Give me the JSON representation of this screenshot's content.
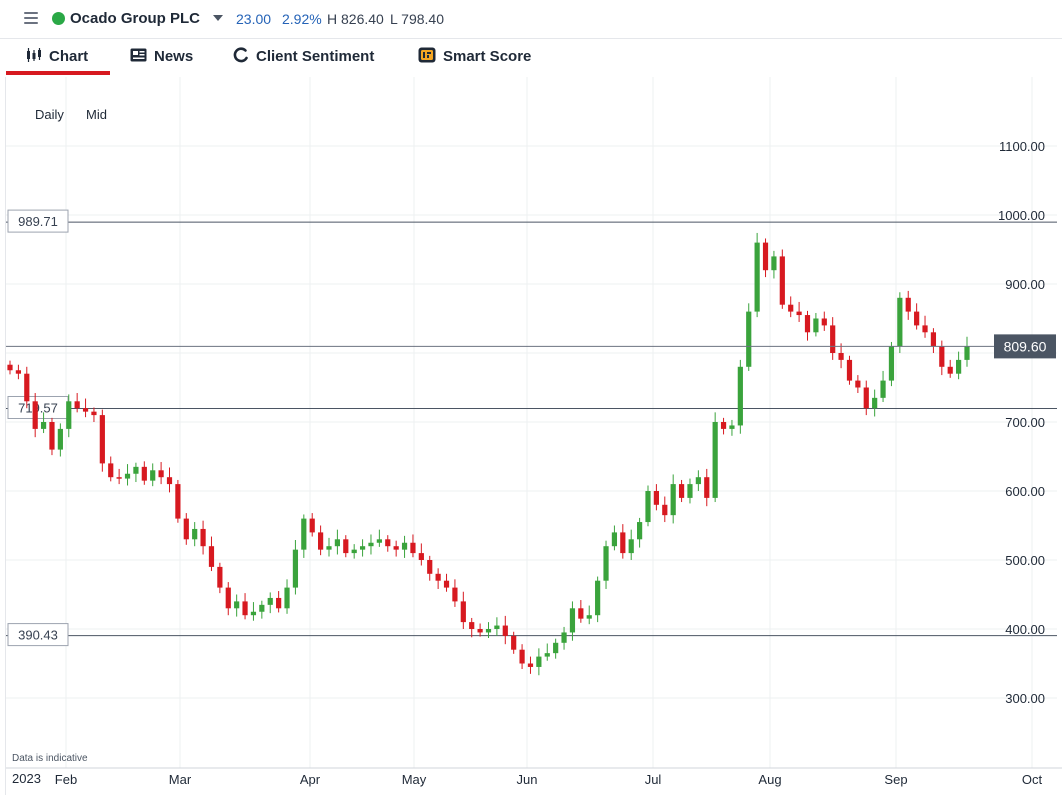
{
  "header": {
    "menu_icon": "hamburger-menu-icon",
    "status_color": "#2aa846",
    "instrument": "Ocado Group PLC",
    "change": "23.00",
    "change_pct": "2.92%",
    "high": "H 826.40",
    "low": "L 798.40"
  },
  "tabs": [
    {
      "label": "Chart",
      "icon": "candlestick-chart-icon",
      "active": true
    },
    {
      "label": "News",
      "icon": "newspaper-icon"
    },
    {
      "label": "Client Sentiment",
      "icon": "sentiment-gauge-icon"
    },
    {
      "label": "Smart Score",
      "icon": "smart-score-icon"
    }
  ],
  "chart_controls": {
    "interval": "Daily",
    "price_type": "Mid"
  },
  "disclaimer": "Data is indicative",
  "colors": {
    "up": "#3aa33c",
    "down": "#d71920",
    "accent": "#d71920",
    "quote": "#2563b7"
  },
  "chart_data": {
    "type": "candlestick",
    "year_label": "2023",
    "x_labels": [
      "Feb",
      "Mar",
      "Apr",
      "May",
      "Jun",
      "Jul",
      "Aug",
      "Sep",
      "Oct"
    ],
    "y_ticks": [
      "1100.00",
      "1000.00",
      "900.00",
      "800.00",
      "700.00",
      "600.00",
      "500.00",
      "400.00",
      "300.00"
    ],
    "ylim": [
      240,
      1200
    ],
    "horizontal_lines": [
      {
        "label": "989.71",
        "value": 989.71
      },
      {
        "label": "719.57",
        "value": 719.57
      },
      {
        "label": "390.43",
        "value": 390.43
      }
    ],
    "current_price": {
      "label": "809.60",
      "value": 809.6
    },
    "closes": [
      775,
      770,
      730,
      690,
      700,
      660,
      690,
      730,
      720,
      715,
      710,
      640,
      620,
      618,
      625,
      635,
      615,
      630,
      620,
      610,
      560,
      530,
      545,
      520,
      490,
      460,
      430,
      440,
      420,
      425,
      435,
      445,
      430,
      460,
      515,
      560,
      540,
      515,
      520,
      530,
      510,
      515,
      520,
      525,
      530,
      520,
      515,
      525,
      510,
      500,
      480,
      470,
      460,
      440,
      410,
      400,
      395,
      400,
      405,
      390,
      370,
      350,
      345,
      360,
      365,
      380,
      395,
      430,
      415,
      420,
      470,
      520,
      540,
      510,
      530,
      555,
      600,
      580,
      565,
      610,
      590,
      610,
      620,
      590,
      700,
      690,
      695,
      780,
      860,
      960,
      920,
      940,
      870,
      860,
      855,
      830,
      850,
      840,
      800,
      790,
      760,
      750,
      720,
      735,
      760,
      810,
      880,
      860,
      840,
      830,
      810,
      780,
      770,
      790,
      809.6
    ]
  }
}
